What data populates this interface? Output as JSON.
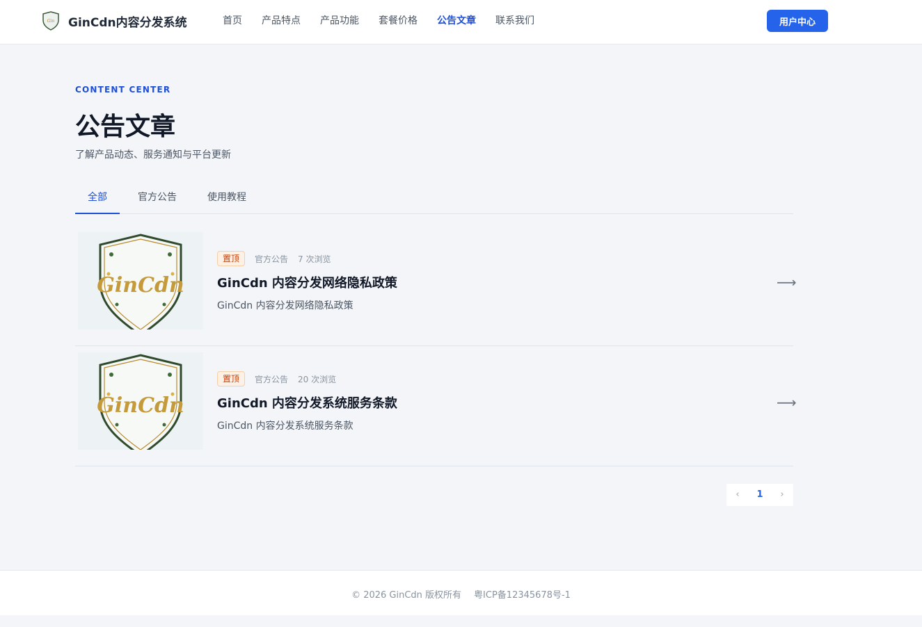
{
  "header": {
    "brand_name": "GinCdn内容分发系统",
    "nav": [
      {
        "label": "首页",
        "active": false
      },
      {
        "label": "产品特点",
        "active": false
      },
      {
        "label": "产品功能",
        "active": false
      },
      {
        "label": "套餐价格",
        "active": false
      },
      {
        "label": "公告文章",
        "active": true
      },
      {
        "label": "联系我们",
        "active": false
      }
    ],
    "user_center_label": "用户中心"
  },
  "hero": {
    "eyebrow": "CONTENT CENTER",
    "title": "公告文章",
    "subtitle": "了解产品动态、服务通知与平台更新"
  },
  "tabs": [
    {
      "label": "全部",
      "active": true
    },
    {
      "label": "官方公告",
      "active": false
    },
    {
      "label": "使用教程",
      "active": false
    }
  ],
  "articles": [
    {
      "badge": "置顶",
      "category": "官方公告",
      "views": "7 次浏览",
      "title": "GinCdn 内容分发网络隐私政策",
      "summary": "GinCdn 内容分发网络隐私政策",
      "logo_text": "GinCdn"
    },
    {
      "badge": "置顶",
      "category": "官方公告",
      "views": "20 次浏览",
      "title": "GinCdn 内容分发系统服务条款",
      "summary": "GinCdn 内容分发系统服务条款",
      "logo_text": "GinCdn"
    }
  ],
  "pagination": {
    "prev": "‹",
    "current": "1",
    "next": "›"
  },
  "footer": {
    "copyright": "© 2026 GinCdn 版权所有",
    "icp": "粤ICP备12345678号-1"
  },
  "colors": {
    "accent": "#2563eb",
    "badge_text": "#c2410c",
    "badge_bg": "#fdf0e4",
    "page_bg": "#f3f5f8"
  },
  "icons": {
    "arrow": "arrow-right-icon",
    "prev": "chevron-left-icon",
    "next": "chevron-right-icon",
    "logo": "shield-logo-icon"
  }
}
